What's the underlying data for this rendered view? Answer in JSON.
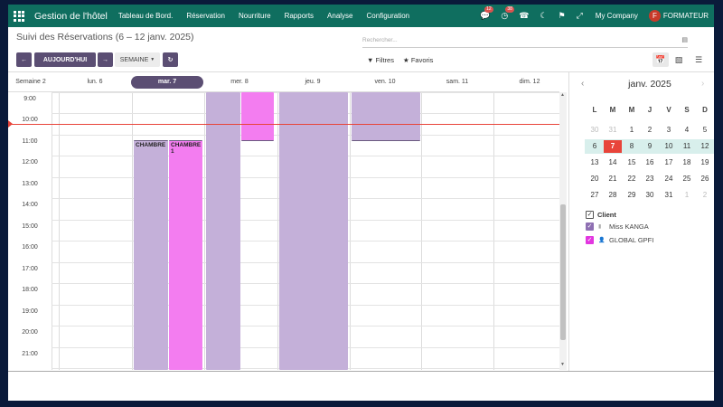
{
  "navbar": {
    "app_name": "Gestion de l'hôtel",
    "menu": [
      "Tableau de Bord.",
      "Réservation",
      "Nourriture",
      "Rapports",
      "Analyse",
      "Configuration"
    ],
    "messages_badge": "12",
    "activity_badge": "38",
    "company": "My Company",
    "user_initial": "F",
    "user": "FORMATEUR"
  },
  "control_panel": {
    "title": "Suivi des Réservations (6 – 12 janv. 2025)",
    "search_placeholder": "Rechercher...",
    "today_label": "AUJOURD'HUI",
    "scale_label": "SEMAINE",
    "filters_label": "Filtres",
    "favorites_label": "Favoris"
  },
  "calendar": {
    "week_label": "Semaine 2",
    "days": [
      {
        "label": "lun. 6",
        "active": false
      },
      {
        "label": "mar. 7",
        "active": true
      },
      {
        "label": "mer. 8",
        "active": false
      },
      {
        "label": "jeu. 9",
        "active": false
      },
      {
        "label": "ven. 10",
        "active": false
      },
      {
        "label": "sam. 11",
        "active": false
      },
      {
        "label": "dim. 12",
        "active": false
      }
    ],
    "hours": [
      "9:00",
      "10:00",
      "11:00",
      "12:00",
      "13:00",
      "14:00",
      "15:00",
      "16:00",
      "17:00",
      "18:00",
      "19:00",
      "20:00",
      "21:00"
    ],
    "events": [
      {
        "label": "CHAMBRE",
        "color": "#c4b0d9"
      },
      {
        "label": "CHAMBRE 1",
        "color": "#f37df0"
      }
    ]
  },
  "side_panel": {
    "month": "janv. 2025",
    "weekdays": [
      "L",
      "M",
      "M",
      "J",
      "V",
      "S",
      "D"
    ],
    "weeks": [
      [
        "30",
        "31",
        "1",
        "2",
        "3",
        "4",
        "5"
      ],
      [
        "6",
        "7",
        "8",
        "9",
        "10",
        "11",
        "12"
      ],
      [
        "13",
        "14",
        "15",
        "16",
        "17",
        "18",
        "19"
      ],
      [
        "20",
        "21",
        "22",
        "23",
        "24",
        "25",
        "26"
      ],
      [
        "27",
        "28",
        "29",
        "30",
        "31",
        "1",
        "2"
      ]
    ],
    "today": "7",
    "filter_title": "Client",
    "filters": [
      {
        "label": "Miss KANGA",
        "color": "#8e6fb2"
      },
      {
        "label": "GLOBAL GPFI",
        "color": "#e236e0"
      }
    ]
  },
  "colors": {
    "navbar": "#0f6e5f",
    "primary": "#5b4e73",
    "today": "#e8443a",
    "event_purple": "#c4b0d9",
    "event_pink": "#f37df0"
  }
}
